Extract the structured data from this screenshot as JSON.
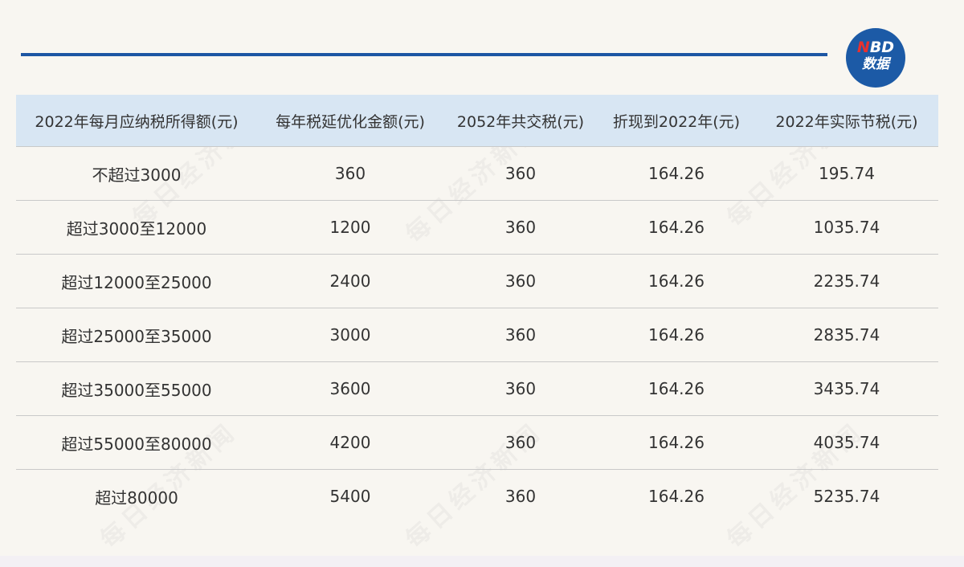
{
  "logo": {
    "line1_n": "N",
    "line1_rest": "BD",
    "line2": "数据"
  },
  "watermark": "每日经济新闻",
  "table": {
    "headers": [
      "2022年每月应纳税所得额(元)",
      "每年税延优化金额(元)",
      "2052年共交税(元)",
      "折现到2022年(元)",
      "2022年实际节税(元)"
    ],
    "rows": [
      [
        "不超过3000",
        "360",
        "360",
        "164.26",
        "195.74"
      ],
      [
        "超过3000至12000",
        "1200",
        "360",
        "164.26",
        "1035.74"
      ],
      [
        "超过12000至25000",
        "2400",
        "360",
        "164.26",
        "2235.74"
      ],
      [
        "超过25000至35000",
        "3000",
        "360",
        "164.26",
        "2835.74"
      ],
      [
        "超过35000至55000",
        "3600",
        "360",
        "164.26",
        "3435.74"
      ],
      [
        "超过55000至80000",
        "4200",
        "360",
        "164.26",
        "4035.74"
      ],
      [
        "超过80000",
        "5400",
        "360",
        "164.26",
        "5235.74"
      ]
    ]
  },
  "colors": {
    "accent_blue": "#1d56a3",
    "header_bg": "#d8e6f3",
    "page_bg": "#f8f6f1",
    "logo_red": "#e8312f"
  }
}
